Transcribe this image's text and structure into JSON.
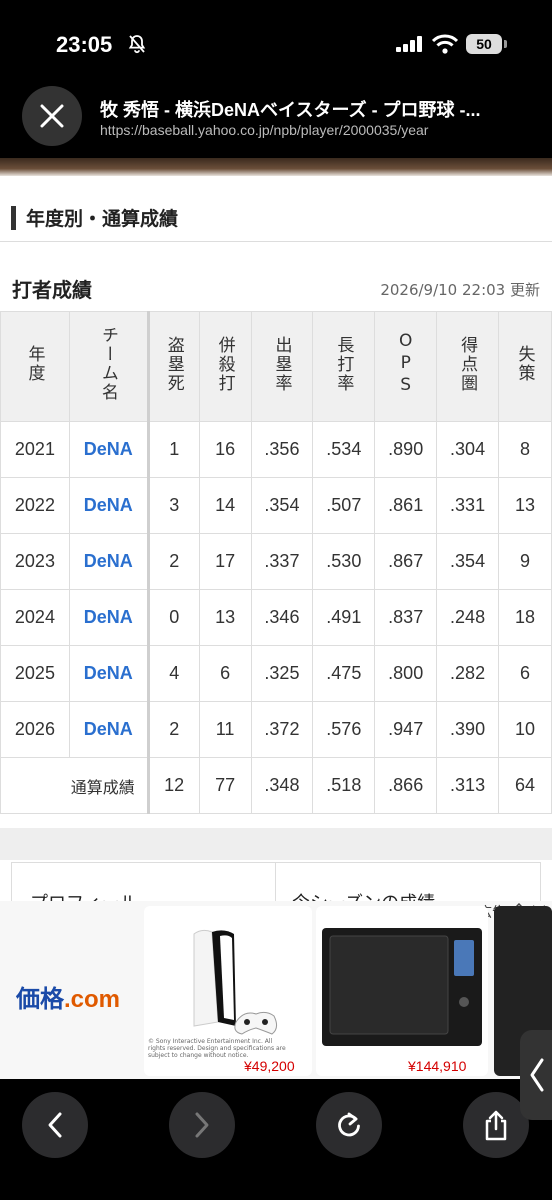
{
  "status": {
    "time": "23:05",
    "battery": "50"
  },
  "browser": {
    "page_title": "牧 秀悟 - 横浜DeNAベイスターズ - プロ野球 -...",
    "url": "https://baseball.yahoo.co.jp/npb/player/2000035/year"
  },
  "section": {
    "title": "年度別・通算成績"
  },
  "stats": {
    "subtitle": "打者成績",
    "updated": "2026/9/10 22:03 更新",
    "headers": [
      "年度",
      "チーム名",
      "盗塁死",
      "併殺打",
      "出塁率",
      "長打率",
      "OPS",
      "得点圏",
      "失策"
    ],
    "rows": [
      {
        "year": "2021",
        "team": "DeNA",
        "cs": "1",
        "gdp": "16",
        "obp": ".356",
        "slg": ".534",
        "ops": ".890",
        "risp": ".304",
        "err": "8"
      },
      {
        "year": "2022",
        "team": "DeNA",
        "cs": "3",
        "gdp": "14",
        "obp": ".354",
        "slg": ".507",
        "ops": ".861",
        "risp": ".331",
        "err": "13"
      },
      {
        "year": "2023",
        "team": "DeNA",
        "cs": "2",
        "gdp": "17",
        "obp": ".337",
        "slg": ".530",
        "ops": ".867",
        "risp": ".354",
        "err": "9"
      },
      {
        "year": "2024",
        "team": "DeNA",
        "cs": "0",
        "gdp": "13",
        "obp": ".346",
        "slg": ".491",
        "ops": ".837",
        "risp": ".248",
        "err": "18"
      },
      {
        "year": "2025",
        "team": "DeNA",
        "cs": "4",
        "gdp": "6",
        "obp": ".325",
        "slg": ".475",
        "ops": ".800",
        "risp": ".282",
        "err": "6"
      },
      {
        "year": "2026",
        "team": "DeNA",
        "cs": "2",
        "gdp": "11",
        "obp": ".372",
        "slg": ".576",
        "ops": ".947",
        "risp": ".390",
        "err": "10"
      }
    ],
    "total": {
      "label": "通算成績",
      "cs": "12",
      "gdp": "77",
      "obp": ".348",
      "slg": ".518",
      "ops": ".866",
      "risp": ".313",
      "err": "64"
    }
  },
  "profile_tabs": [
    "プロフィール",
    "今シーズンの成績"
  ],
  "ad": {
    "logo_main": "価格",
    "logo_suffix": ".com",
    "label": "広告",
    "fine_print": "© Sony Interactive Entertainment Inc. All rights reserved. Design and specifications are subject to change without notice.",
    "items": [
      {
        "price": "¥49,200"
      },
      {
        "price": "¥144,910"
      }
    ]
  }
}
